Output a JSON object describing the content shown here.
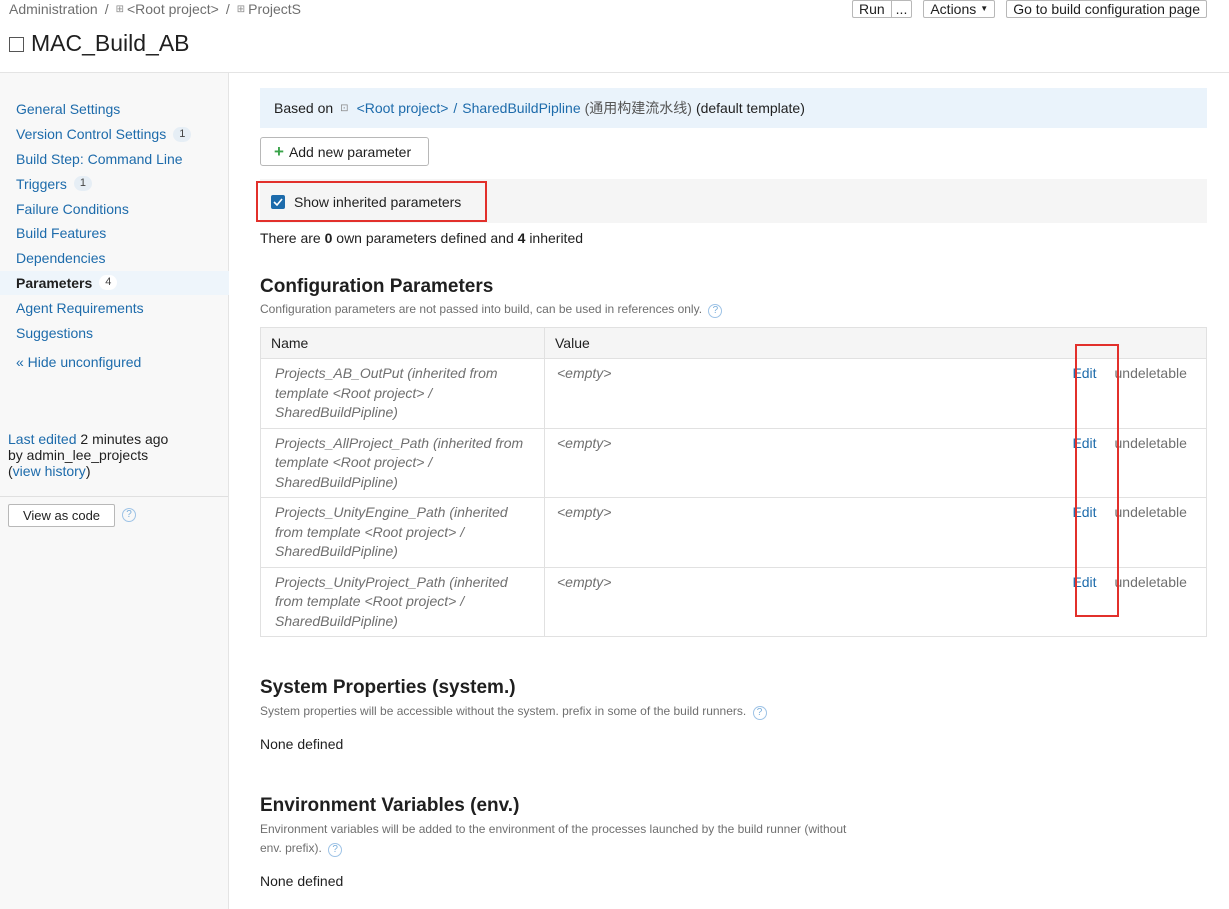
{
  "breadcrumb": {
    "items": [
      "Administration",
      "<Root project>",
      "ProjectS"
    ],
    "separator": "/"
  },
  "page_title": "MAC_Build_AB",
  "top_actions": {
    "run_label": "Run",
    "run_more_label": "...",
    "actions_label": "Actions",
    "goto_label": "Go to build configuration page"
  },
  "sidebar": {
    "items": [
      {
        "label": "General Settings",
        "count": null,
        "active": false
      },
      {
        "label": "Version Control Settings",
        "count": "1",
        "active": false
      },
      {
        "label": "Build Step: Command Line",
        "count": null,
        "active": false
      },
      {
        "label": "Triggers",
        "count": "1",
        "active": false
      },
      {
        "label": "Failure Conditions",
        "count": null,
        "active": false
      },
      {
        "label": "Build Features",
        "count": null,
        "active": false
      },
      {
        "label": "Dependencies",
        "count": null,
        "active": false
      },
      {
        "label": "Parameters",
        "count": "4",
        "active": true
      },
      {
        "label": "Agent Requirements",
        "count": null,
        "active": false
      },
      {
        "label": "Suggestions",
        "count": null,
        "active": false
      }
    ],
    "hide_unconfigured": "« Hide unconfigured",
    "last_edited_prefix": "Last edited",
    "last_edited_time": "2 minutes ago",
    "last_edited_by": "by admin_lee_projects",
    "view_history": "view history",
    "view_as_code": "View as code"
  },
  "based_on": {
    "prefix": "Based on",
    "root_link": "<Root project>",
    "slash": "/",
    "template_link": "SharedBuildPipline",
    "template_note": "(通用构建流水线)",
    "suffix": "(default template)"
  },
  "add_parameter_label": "Add new parameter",
  "show_inherited": {
    "label": "Show inherited parameters",
    "checked": true
  },
  "summary": {
    "before": "There are",
    "own": "0",
    "middle": "own parameters defined and",
    "inherited": "4",
    "after": "inherited"
  },
  "config_params": {
    "title": "Configuration Parameters",
    "description": "Configuration parameters are not passed into build, can be used in references only.",
    "columns": [
      "Name",
      "Value"
    ],
    "rows": [
      {
        "name": "Projects_AB_OutPut (inherited from template <Root project> / SharedBuildPipline)",
        "value": "<empty>",
        "edit": "Edit",
        "status": "undeletable"
      },
      {
        "name": "Projects_AllProject_Path (inherited from template <Root project> / SharedBuildPipline)",
        "value": "<empty>",
        "edit": "Edit",
        "status": "undeletable"
      },
      {
        "name": "Projects_UnityEngine_Path (inherited from template <Root project> / SharedBuildPipline)",
        "value": "<empty>",
        "edit": "Edit",
        "status": "undeletable"
      },
      {
        "name": "Projects_UnityProject_Path (inherited from template <Root project> / SharedBuildPipline)",
        "value": "<empty>",
        "edit": "Edit",
        "status": "undeletable"
      }
    ]
  },
  "system_props": {
    "title": "System Properties (system.)",
    "description": "System properties will be accessible without the system. prefix in some of the build runners.",
    "empty_text": "None defined"
  },
  "env_vars": {
    "title": "Environment Variables (env.)",
    "description_line1": "Environment variables will be added to the environment of the processes launched by the build runner (without",
    "description_line2": "env. prefix).",
    "empty_text": "None defined"
  },
  "colors": {
    "link": "#1d6bab",
    "highlight_border": "#e2302b",
    "info_bg": "#eaf3fb",
    "add_icon": "#3aa34a"
  }
}
